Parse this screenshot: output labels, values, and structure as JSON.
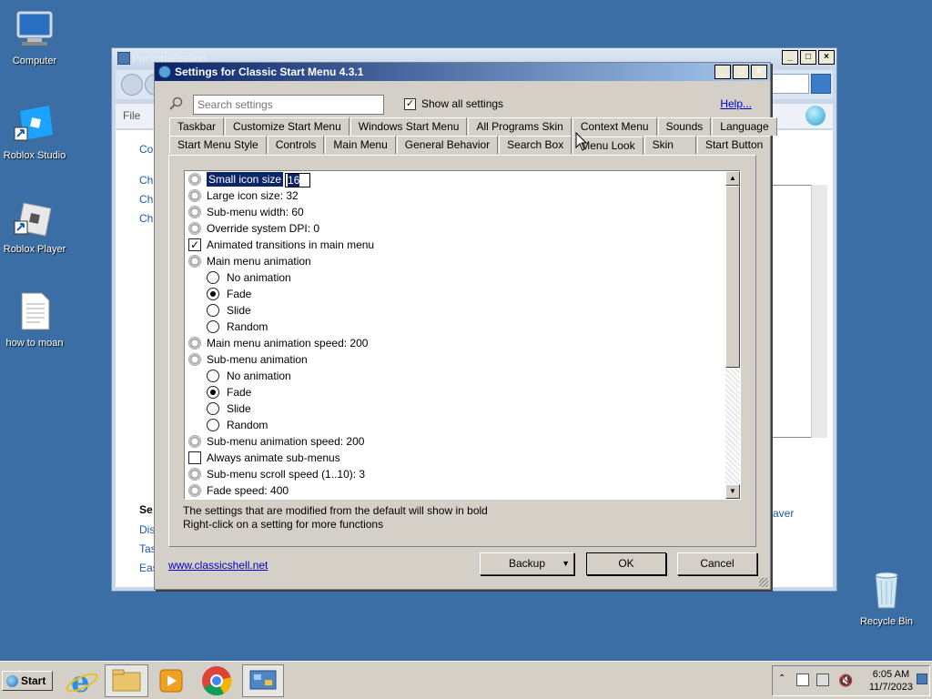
{
  "desktop": {
    "icons": [
      {
        "label": "Computer"
      },
      {
        "label": "Roblox Studio"
      },
      {
        "label": "Roblox Player"
      },
      {
        "label": "how to moan"
      },
      {
        "label": "Recycle Bin"
      }
    ]
  },
  "background_window": {
    "title": "Personalization",
    "menu_file": "File",
    "left_text_top": "Co",
    "left_links": [
      "Ch",
      "Ch",
      "Ch"
    ],
    "left_heading": "Se",
    "left_bottom": [
      "Dis",
      "Tas",
      "Eas"
    ],
    "right_fragment": "aver"
  },
  "dialog": {
    "title": "Settings for Classic Start Menu 4.3.1",
    "search_placeholder": "Search settings",
    "show_all_label": "Show all settings",
    "show_all_checked": "✓",
    "help_link": "Help...",
    "tabs_row1": [
      "Taskbar",
      "Customize Start Menu",
      "Windows Start Menu",
      "All Programs Skin",
      "Context Menu",
      "Sounds",
      "Language"
    ],
    "tabs_row2": [
      "Start Menu Style",
      "Controls",
      "Main Menu",
      "General Behavior",
      "Search Box",
      "Menu Look",
      "Skin",
      "Start Button"
    ],
    "active_tab": "Menu Look",
    "selected_setting_label": "Small icon size",
    "selected_setting_value": "16",
    "settings": [
      {
        "label": "Large icon size: 32",
        "kind": "gear"
      },
      {
        "label": "Sub-menu width: 60",
        "kind": "gear"
      },
      {
        "label": "Override system DPI: 0",
        "kind": "gear"
      },
      {
        "label": "Animated transitions in main menu",
        "kind": "check",
        "mark": "✓"
      },
      {
        "label": "Main menu animation",
        "kind": "gear"
      },
      {
        "label": "No animation",
        "kind": "radio"
      },
      {
        "label": "Fade",
        "kind": "radio-on"
      },
      {
        "label": "Slide",
        "kind": "radio"
      },
      {
        "label": "Random",
        "kind": "radio"
      },
      {
        "label": "Main menu animation speed: 200",
        "kind": "gear"
      },
      {
        "label": "Sub-menu animation",
        "kind": "gear"
      },
      {
        "label": "No animation",
        "kind": "radio"
      },
      {
        "label": "Fade",
        "kind": "radio-on"
      },
      {
        "label": "Slide",
        "kind": "radio"
      },
      {
        "label": "Random",
        "kind": "radio"
      },
      {
        "label": "Sub-menu animation speed: 200",
        "kind": "gear"
      },
      {
        "label": "Always animate sub-menus",
        "kind": "check",
        "mark": ""
      },
      {
        "label": "Sub-menu scroll speed (1..10): 3",
        "kind": "gear"
      },
      {
        "label": "Fade speed: 400",
        "kind": "gear"
      }
    ],
    "footnote_line1": "The settings that are modified from the default will show in bold",
    "footnote_line2": "Right-click on a setting for more functions",
    "site_link": "www.classicshell.net",
    "buttons": {
      "backup": "Backup",
      "ok": "OK",
      "cancel": "Cancel"
    }
  },
  "taskbar": {
    "start_label": "Start",
    "time": "6:05 AM",
    "date": "11/7/2023"
  }
}
